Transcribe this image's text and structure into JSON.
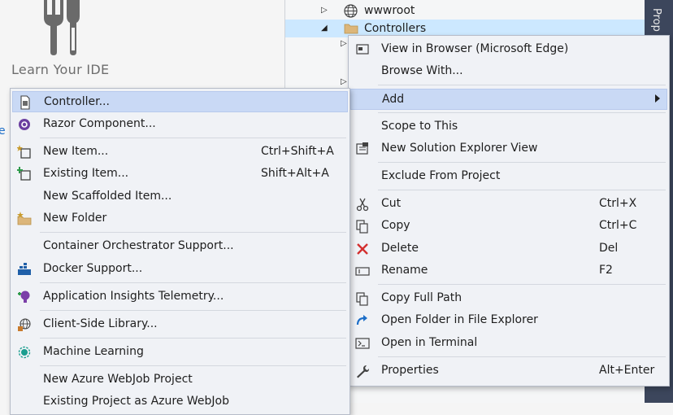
{
  "start_page": {
    "title": "Learn Your IDE",
    "edge_text": "e"
  },
  "solution_explorer": {
    "items": [
      {
        "label": "wwwroot"
      },
      {
        "label": "Controllers"
      }
    ],
    "properties_tab": "Prop"
  },
  "context_menu": {
    "view_in_browser": "View in Browser (Microsoft Edge)",
    "browse_with": "Browse With...",
    "add": "Add",
    "scope_to_this": "Scope to This",
    "new_solution_explorer_view": "New Solution Explorer View",
    "exclude_from_project": "Exclude From Project",
    "cut": {
      "label": "Cut",
      "shortcut": "Ctrl+X"
    },
    "copy": {
      "label": "Copy",
      "shortcut": "Ctrl+C"
    },
    "delete": {
      "label": "Delete",
      "shortcut": "Del"
    },
    "rename": {
      "label": "Rename",
      "shortcut": "F2"
    },
    "copy_full_path": "Copy Full Path",
    "open_folder_in_file_explorer": "Open Folder in File Explorer",
    "open_in_terminal": "Open in Terminal",
    "properties": {
      "label": "Properties",
      "shortcut": "Alt+Enter"
    }
  },
  "add_submenu": {
    "controller": "Controller...",
    "razor_component": "Razor Component...",
    "new_item": {
      "label": "New Item...",
      "shortcut": "Ctrl+Shift+A"
    },
    "existing_item": {
      "label": "Existing Item...",
      "shortcut": "Shift+Alt+A"
    },
    "new_scaffolded_item": "New Scaffolded Item...",
    "new_folder": "New Folder",
    "container_orchestrator_support": "Container Orchestrator Support...",
    "docker_support": "Docker Support...",
    "application_insights_telemetry": "Application Insights Telemetry...",
    "client_side_library": "Client-Side Library...",
    "machine_learning": "Machine Learning",
    "new_azure_webjob_project": "New Azure WebJob Project",
    "existing_project_as_azure_webjob": "Existing Project as Azure WebJob"
  },
  "colors": {
    "highlight": "#c9d9f5",
    "menu_bg": "#f0f2f6",
    "selection": "#cce8ff",
    "delete_red": "#d32f2f",
    "razor_purple": "#6b3fa0",
    "docker_blue": "#1f5fa8"
  }
}
